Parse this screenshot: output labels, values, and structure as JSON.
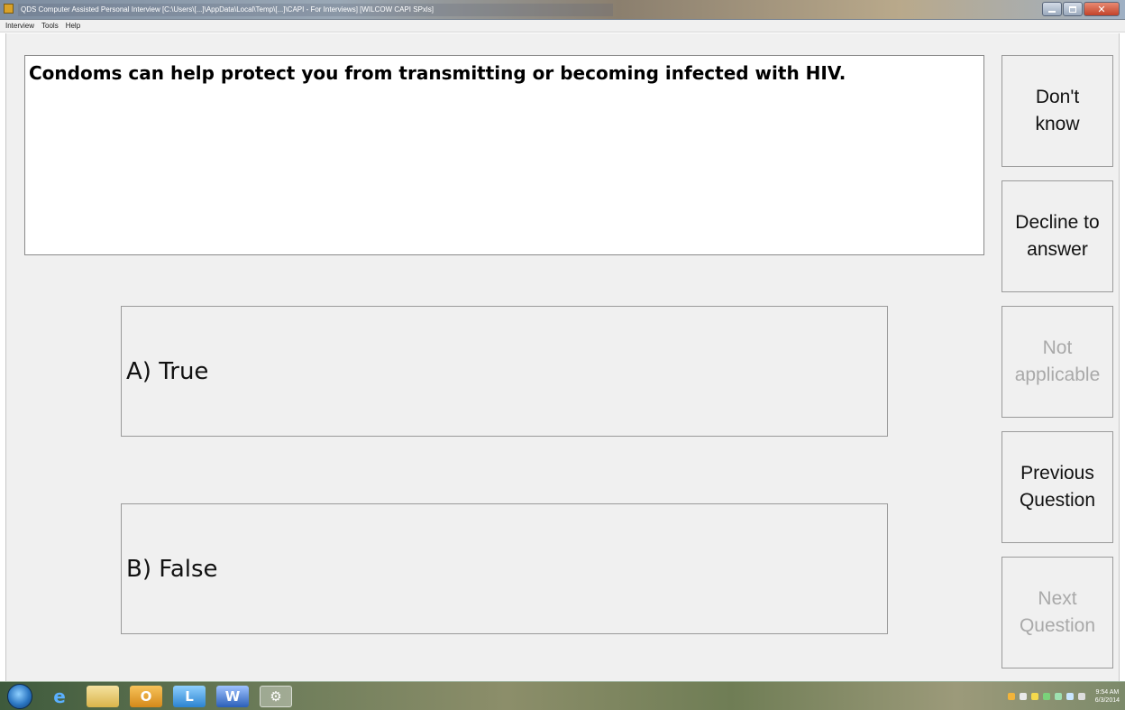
{
  "window": {
    "title": "QDS Computer Assisted Personal Interview [C:\\Users\\[...]\\AppData\\Local\\Temp\\[...]\\CAPI - For Interviews] [WILCOW CAPI SPxls]",
    "controls": [
      "minimize",
      "maximize",
      "close"
    ]
  },
  "menu": {
    "items": [
      "Interview",
      "Tools",
      "Help"
    ]
  },
  "question": {
    "text": "Condoms can help protect you from transmitting or becoming infected with HIV."
  },
  "answers": [
    {
      "label": "A) True"
    },
    {
      "label": "B) False"
    }
  ],
  "side_buttons": [
    {
      "label": "Don't\nknow",
      "enabled": true
    },
    {
      "label": "Decline to\nanswer",
      "enabled": true
    },
    {
      "label": "Not\napplicable",
      "enabled": false
    },
    {
      "label": "Previous\nQuestion",
      "enabled": true
    },
    {
      "label": "Next\nQuestion",
      "enabled": false
    }
  ],
  "taskbar": {
    "pinned": [
      "internet-explorer-icon",
      "file-explorer-icon",
      "outlook-icon",
      "lync-icon",
      "word-icon",
      "generic-app-icon"
    ],
    "clock_time": "9:54 AM",
    "clock_date": "6/3/2014"
  },
  "colors": {
    "client_bg": "#f0f0f0",
    "disabled_text": "#a9a9a9",
    "border": "#9a9a9a"
  }
}
